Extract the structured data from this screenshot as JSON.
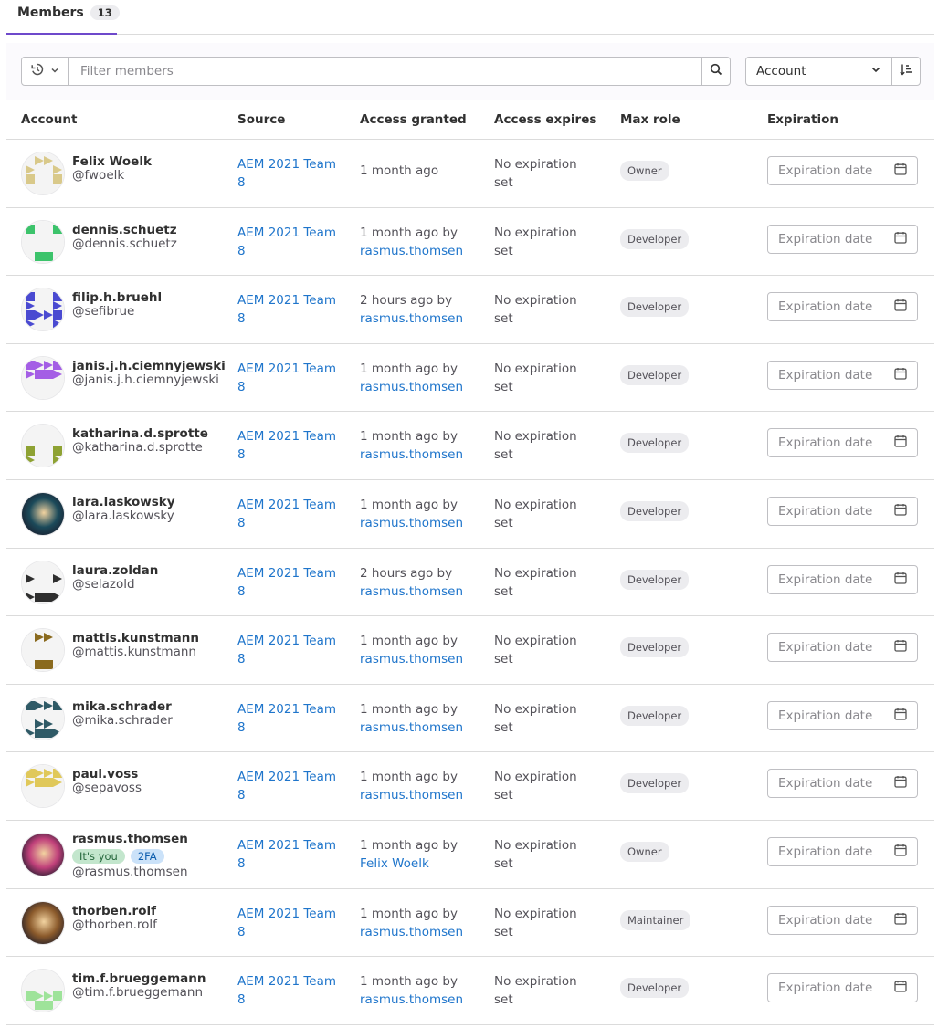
{
  "tabs": {
    "members_label": "Members",
    "members_count": "13"
  },
  "filter": {
    "placeholder": "Filter members",
    "sort_label": "Account"
  },
  "columns": {
    "account": "Account",
    "source": "Source",
    "access_granted": "Access granted",
    "access_expires": "Access expires",
    "max_role": "Max role",
    "expiration": "Expiration"
  },
  "colors": {
    "accent": "#6e49cb",
    "link": "#1f75cb"
  },
  "members": [
    {
      "name": "Felix Woelk",
      "username": "@fwoelk",
      "source_line1": "AEM 2021 Team",
      "source_line2": "8",
      "granted": "1 month ago",
      "granted_by": "",
      "expires_line1": "No expiration",
      "expires_line2": "set",
      "role": "Owner",
      "expiration_placeholder": "Expiration date",
      "avatar": {
        "type": "identicon",
        "color": "#d9c98a"
      }
    },
    {
      "name": "dennis.schuetz",
      "username": "@dennis.schuetz",
      "source_line1": "AEM 2021 Team",
      "source_line2": "8",
      "granted": "1 month ago by",
      "granted_by": "rasmus.thomsen",
      "expires_line1": "No expiration",
      "expires_line2": "set",
      "role": "Developer",
      "expiration_placeholder": "Expiration date",
      "avatar": {
        "type": "identicon",
        "color": "#3cc36b"
      }
    },
    {
      "name": "filip.h.bruehl",
      "username": "@sefibrue",
      "source_line1": "AEM 2021 Team",
      "source_line2": "8",
      "granted": "2 hours ago by",
      "granted_by": "rasmus.thomsen",
      "expires_line1": "No expiration",
      "expires_line2": "set",
      "role": "Developer",
      "expiration_placeholder": "Expiration date",
      "avatar": {
        "type": "identicon",
        "color": "#4a4ad1"
      }
    },
    {
      "name": "janis.j.h.ciemnyjewski",
      "username": "@janis.j.h.ciemnyjewski",
      "source_line1": "AEM 2021 Team",
      "source_line2": "8",
      "granted": "1 month ago by",
      "granted_by": "rasmus.thomsen",
      "expires_line1": "No expiration",
      "expires_line2": "set",
      "role": "Developer",
      "expiration_placeholder": "Expiration date",
      "avatar": {
        "type": "identicon",
        "color": "#a45ee5"
      }
    },
    {
      "name": "katharina.d.sprotte",
      "username": "@katharina.d.sprotte",
      "source_line1": "AEM 2021 Team",
      "source_line2": "8",
      "granted": "1 month ago by",
      "granted_by": "rasmus.thomsen",
      "expires_line1": "No expiration",
      "expires_line2": "set",
      "role": "Developer",
      "expiration_placeholder": "Expiration date",
      "avatar": {
        "type": "identicon",
        "color": "#8ea233"
      }
    },
    {
      "name": "lara.laskowsky",
      "username": "@lara.laskowsky",
      "source_line1": "AEM 2021 Team",
      "source_line2": "8",
      "granted": "1 month ago by",
      "granted_by": "rasmus.thomsen",
      "expires_line1": "No expiration",
      "expires_line2": "set",
      "role": "Developer",
      "expiration_placeholder": "Expiration date",
      "avatar": {
        "type": "photo",
        "color": "#1b4a5a"
      }
    },
    {
      "name": "laura.zoldan",
      "username": "@selazold",
      "source_line1": "AEM 2021 Team",
      "source_line2": "8",
      "granted": "2 hours ago by",
      "granted_by": "rasmus.thomsen",
      "expires_line1": "No expiration",
      "expires_line2": "set",
      "role": "Developer",
      "expiration_placeholder": "Expiration date",
      "avatar": {
        "type": "identicon",
        "color": "#2e2e2e"
      }
    },
    {
      "name": "mattis.kunstmann",
      "username": "@mattis.kunstmann",
      "source_line1": "AEM 2021 Team",
      "source_line2": "8",
      "granted": "1 month ago by",
      "granted_by": "rasmus.thomsen",
      "expires_line1": "No expiration",
      "expires_line2": "set",
      "role": "Developer",
      "expiration_placeholder": "Expiration date",
      "avatar": {
        "type": "identicon",
        "color": "#8a6a1e"
      }
    },
    {
      "name": "mika.schrader",
      "username": "@mika.schrader",
      "source_line1": "AEM 2021 Team",
      "source_line2": "8",
      "granted": "1 month ago by",
      "granted_by": "rasmus.thomsen",
      "expires_line1": "No expiration",
      "expires_line2": "set",
      "role": "Developer",
      "expiration_placeholder": "Expiration date",
      "avatar": {
        "type": "identicon",
        "color": "#2f5a66"
      }
    },
    {
      "name": "paul.voss",
      "username": "@sepavoss",
      "source_line1": "AEM 2021 Team",
      "source_line2": "8",
      "granted": "1 month ago by",
      "granted_by": "rasmus.thomsen",
      "expires_line1": "No expiration",
      "expires_line2": "set",
      "role": "Developer",
      "expiration_placeholder": "Expiration date",
      "avatar": {
        "type": "identicon",
        "color": "#e0c85a"
      }
    },
    {
      "name": "rasmus.thomsen",
      "username": "@rasmus.thomsen",
      "badge_you": "It's you",
      "badge_2fa": "2FA",
      "source_line1": "AEM 2021 Team",
      "source_line2": "8",
      "granted": "1 month ago by",
      "granted_by": "Felix Woelk",
      "expires_line1": "No expiration",
      "expires_line2": "set",
      "role": "Owner",
      "expiration_placeholder": "Expiration date",
      "avatar": {
        "type": "photo",
        "color": "#c0407a"
      }
    },
    {
      "name": "thorben.rolf",
      "username": "@thorben.rolf",
      "source_line1": "AEM 2021 Team",
      "source_line2": "8",
      "granted": "1 month ago by",
      "granted_by": "rasmus.thomsen",
      "expires_line1": "No expiration",
      "expires_line2": "set",
      "role": "Maintainer",
      "expiration_placeholder": "Expiration date",
      "avatar": {
        "type": "photo",
        "color": "#8b5a2b"
      }
    },
    {
      "name": "tim.f.brueggemann",
      "username": "@tim.f.brueggemann",
      "source_line1": "AEM 2021 Team",
      "source_line2": "8",
      "granted": "1 month ago by",
      "granted_by": "rasmus.thomsen",
      "expires_line1": "No expiration",
      "expires_line2": "set",
      "role": "Developer",
      "expiration_placeholder": "Expiration date",
      "avatar": {
        "type": "identicon",
        "color": "#9ee39a"
      }
    }
  ]
}
